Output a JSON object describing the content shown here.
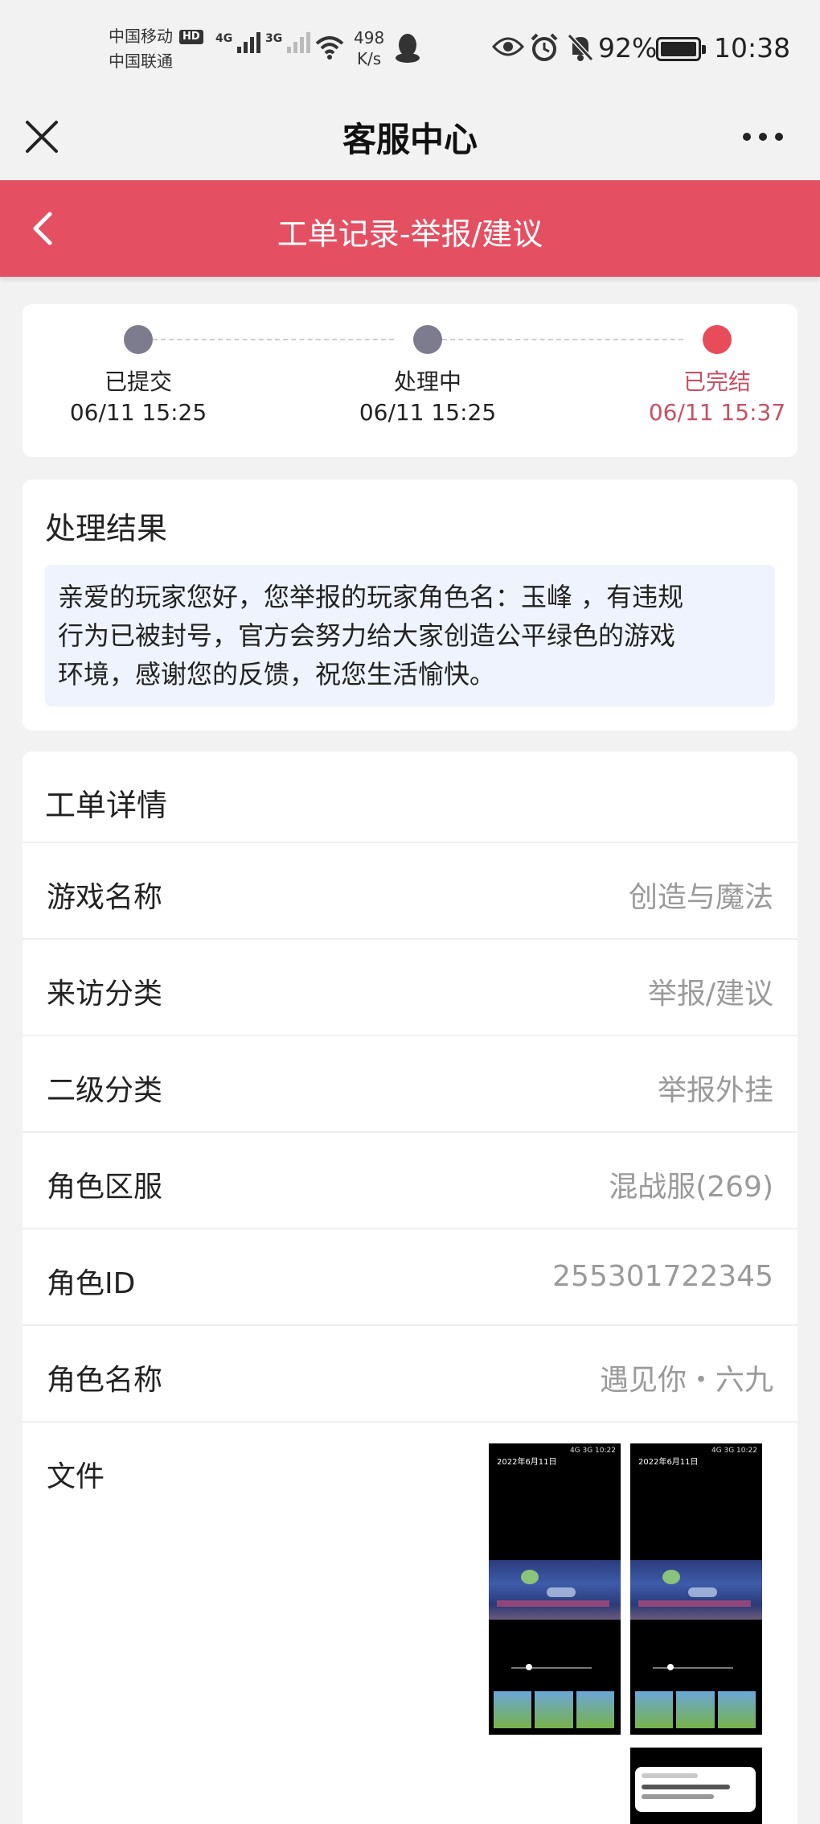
{
  "status_bar": {
    "carrier_1": "中国移动",
    "carrier_1_badge": "HD",
    "carrier_2": "中国联通",
    "sim1_network": "4G",
    "sim2_network": "3G",
    "net_speed_value": "498",
    "net_speed_unit": "K/s",
    "battery_percent": "92%",
    "time": "10:38"
  },
  "titlebar": {
    "title": "客服中心",
    "close_icon": "close-icon",
    "more_icon": "more-icon"
  },
  "header": {
    "title": "工单记录-举报/建议",
    "back_icon": "chevron-left-icon",
    "color": "#e45062"
  },
  "progress": {
    "steps": [
      {
        "label": "已提交",
        "time": "06/11 15:25"
      },
      {
        "label": "处理中",
        "time": "06/11 15:25"
      },
      {
        "label": "已完结",
        "time": "06/11 15:37"
      }
    ],
    "active_color": "#e84c5b",
    "inactive_color": "#7c7c8e"
  },
  "result": {
    "title": "处理结果",
    "lines": [
      "亲爱的玩家您好，您举报的玩家角色名：玉峰 ，有违规",
      "行为已被封号，官方会努力给大家创造公平绿色的游戏",
      "环境，感谢您的反馈，祝您生活愉快。"
    ]
  },
  "detail": {
    "title": "工单详情",
    "rows": [
      {
        "key": "游戏名称",
        "value": "创造与魔法"
      },
      {
        "key": "来访分类",
        "value": "举报/建议"
      },
      {
        "key": "二级分类",
        "value": "举报外挂"
      },
      {
        "key": "角色区服",
        "value": "混战服(269)"
      },
      {
        "key": "角色ID",
        "value": "255301722345"
      },
      {
        "key": "角色名称",
        "value": "遇见你・六九"
      }
    ],
    "file_label": "文件",
    "thumbnails": [
      {
        "title": "2022年6月11日",
        "status": "4G 3G 10:22"
      },
      {
        "title": "2022年6月11日",
        "status": "4G 3G 10:22"
      },
      {
        "title": "",
        "status": ""
      }
    ]
  }
}
